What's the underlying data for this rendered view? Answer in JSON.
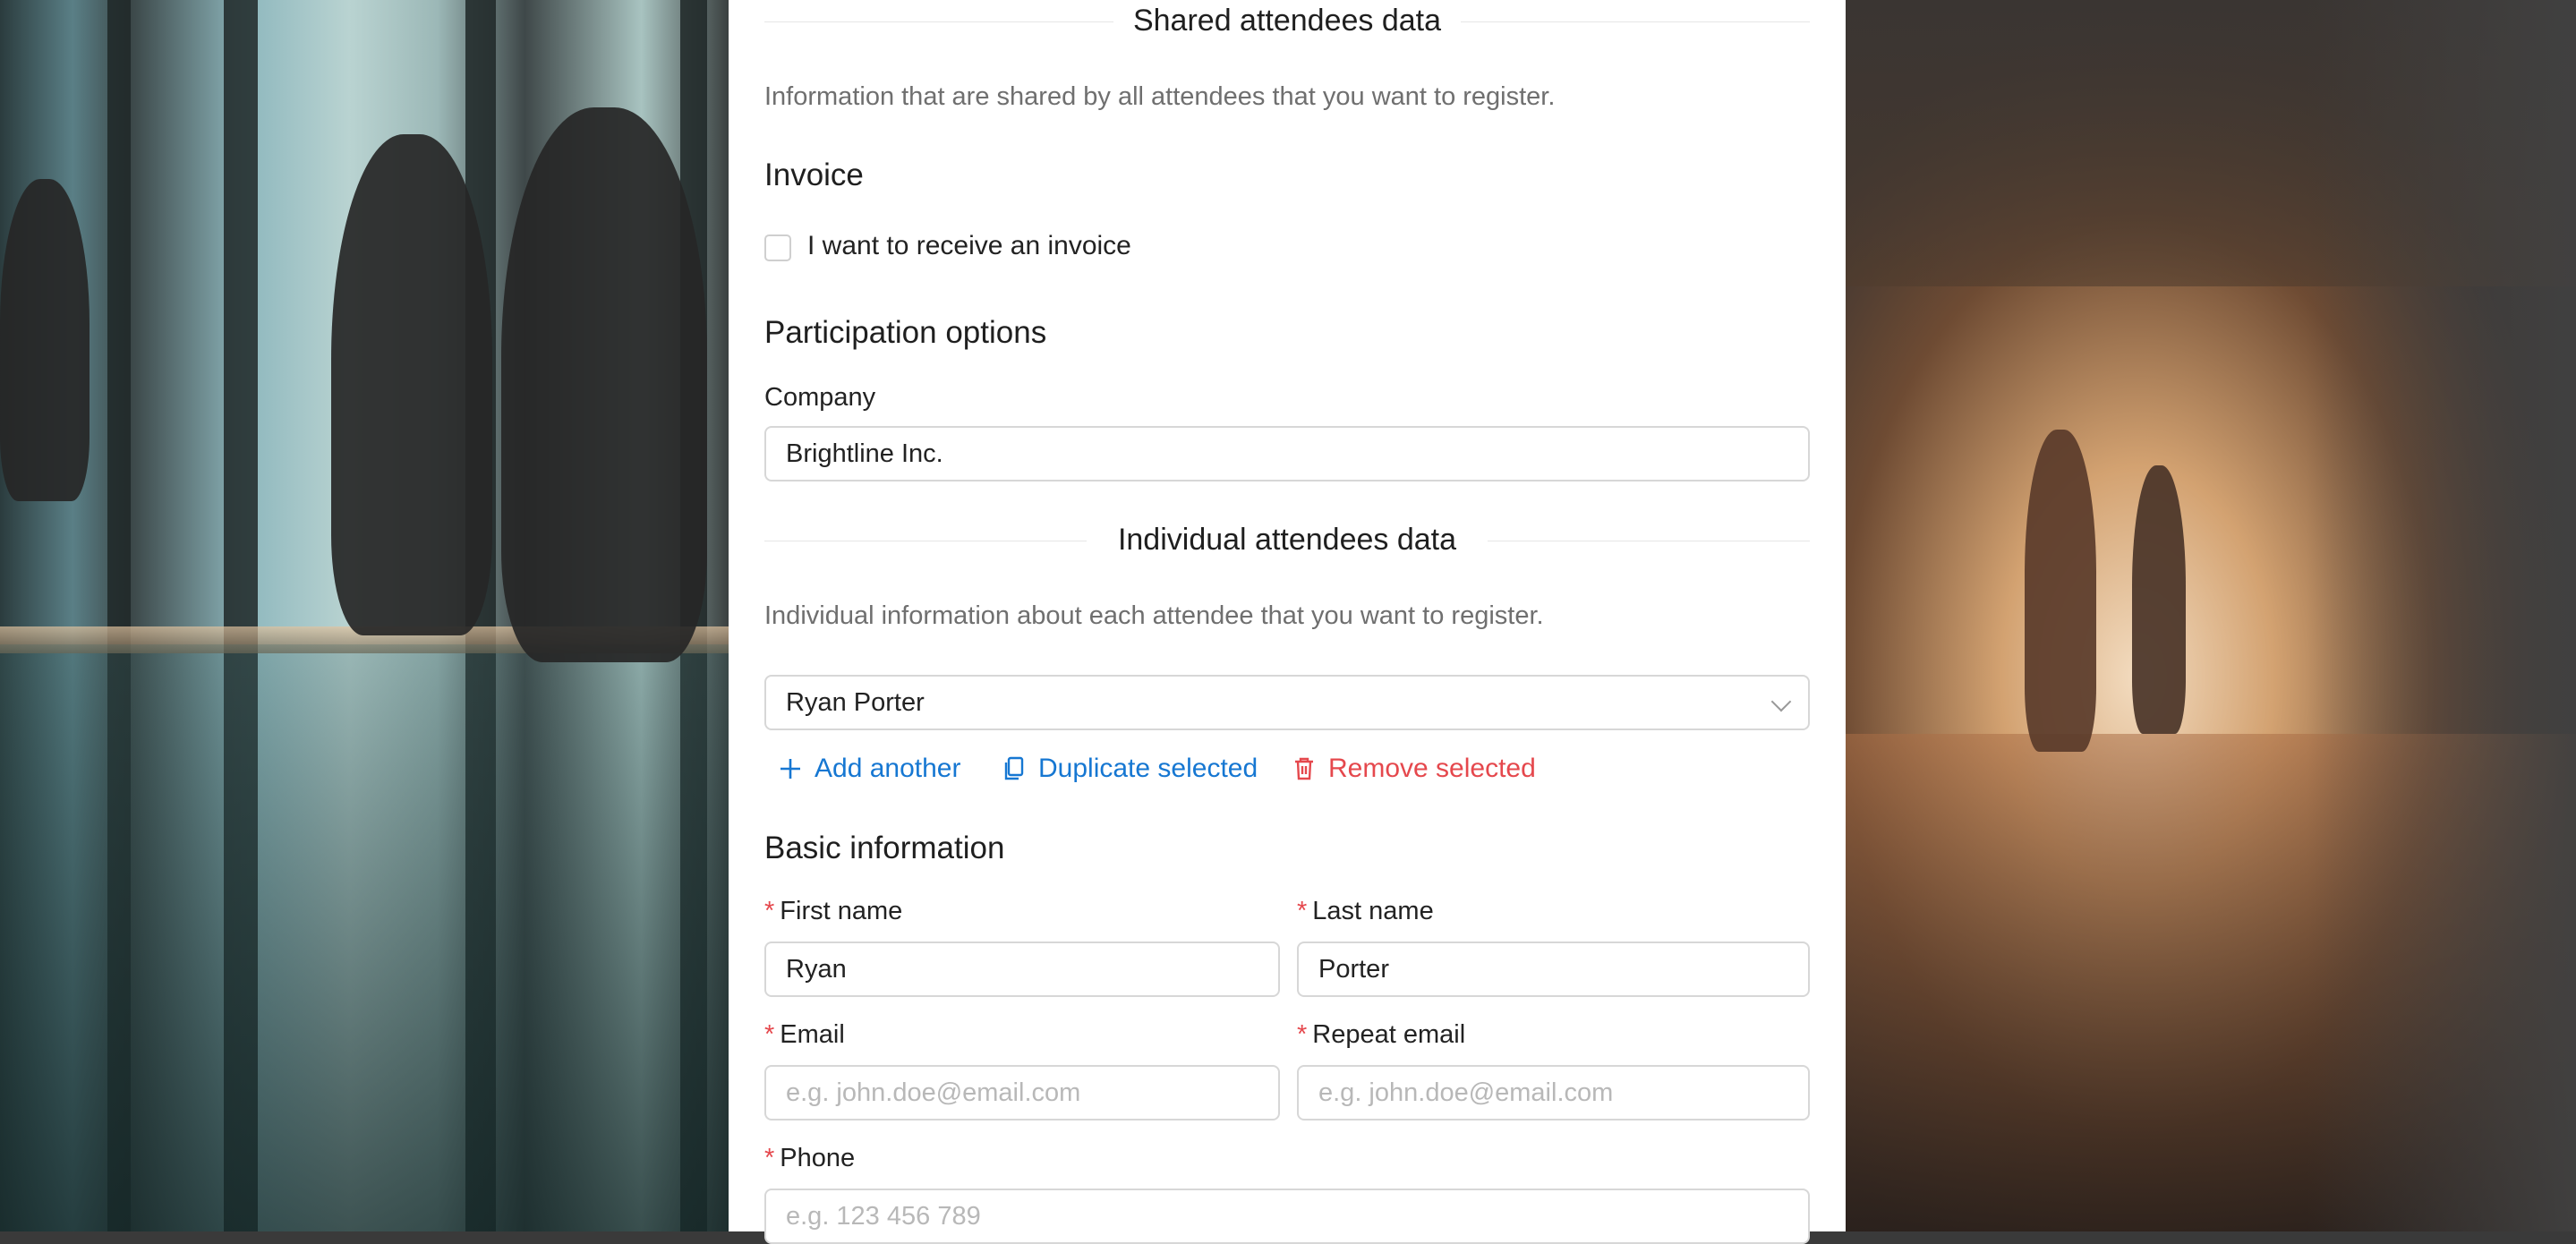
{
  "sections": {
    "shared_title": "Shared attendees data",
    "shared_desc": "Information that are shared by all attendees that you want to register.",
    "individual_title": "Individual attendees data",
    "individual_desc": "Individual information about each attendee that you want to register."
  },
  "invoice": {
    "heading": "Invoice",
    "checkbox_label": "I want to receive an invoice",
    "checked": false
  },
  "participation": {
    "heading": "Participation options",
    "company_label": "Company",
    "company_value": "Brightline Inc."
  },
  "attendee_select": {
    "selected": "Ryan Porter"
  },
  "actions": {
    "add": "Add another",
    "duplicate": "Duplicate selected",
    "remove": "Remove selected"
  },
  "basic": {
    "heading": "Basic information",
    "required_mark": "*",
    "first_name_label": "First name",
    "first_name_value": "Ryan",
    "last_name_label": "Last name",
    "last_name_value": "Porter",
    "email_label": "Email",
    "email_placeholder": "e.g. john.doe@email.com",
    "repeat_email_label": "Repeat email",
    "repeat_email_placeholder": "e.g. john.doe@email.com",
    "phone_label": "Phone",
    "phone_placeholder": "e.g. 123 456 789"
  },
  "colors": {
    "link_blue": "#1677d2",
    "danger_red": "#e5484d",
    "border_gray": "#d7d7d7"
  }
}
